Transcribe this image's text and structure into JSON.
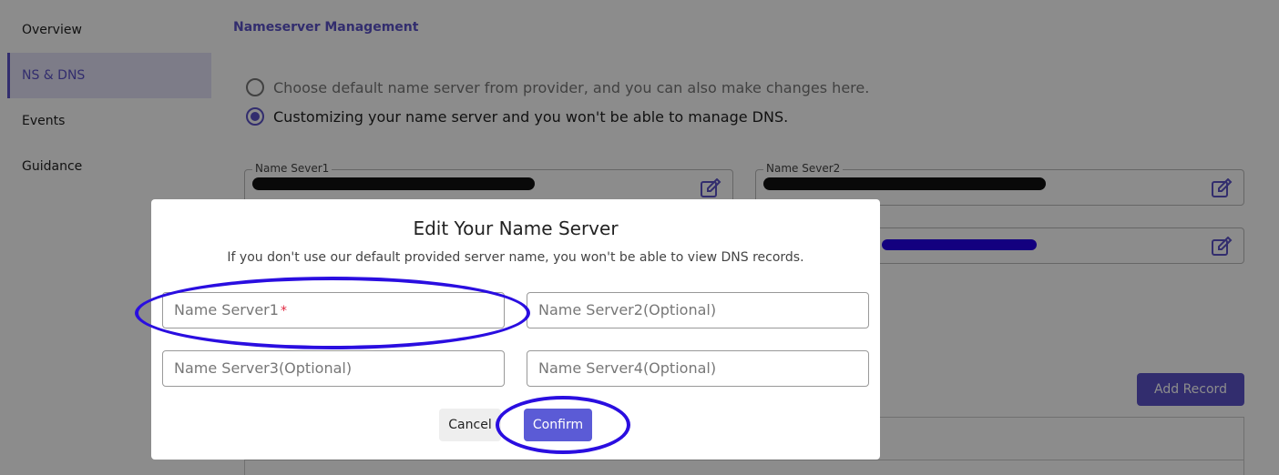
{
  "sidebar": {
    "items": [
      {
        "label": "Overview"
      },
      {
        "label": "NS & DNS"
      },
      {
        "label": "Events"
      },
      {
        "label": "Guidance"
      }
    ]
  },
  "tabs": {
    "active_label": "Nameserver Management"
  },
  "options": {
    "default_label": "Choose default name server from provider, and you can also make changes here.",
    "custom_label": "Customizing your name server and you won't be able to manage DNS."
  },
  "nameservers": {
    "ns1_label": "Name Sever1",
    "ns2_label": "Name Sever2"
  },
  "records": {
    "add_label": "Add Record"
  },
  "modal": {
    "title": "Edit Your Name Server",
    "subtitle": "If you don't use our default provided server name, you won't be able to view DNS records.",
    "ns1_placeholder": "Name Server1",
    "ns1_required": "*",
    "ns2_placeholder": "Name Server2(Optional)",
    "ns3_placeholder": "Name Server3(Optional)",
    "ns4_placeholder": "Name Server4(Optional)",
    "cancel_label": "Cancel",
    "confirm_label": "Confirm"
  },
  "colors": {
    "accent": "#5b52c8",
    "annotation": "#2a0ee0",
    "required": "#e0273f"
  },
  "icons": [
    "edit-icon"
  ]
}
